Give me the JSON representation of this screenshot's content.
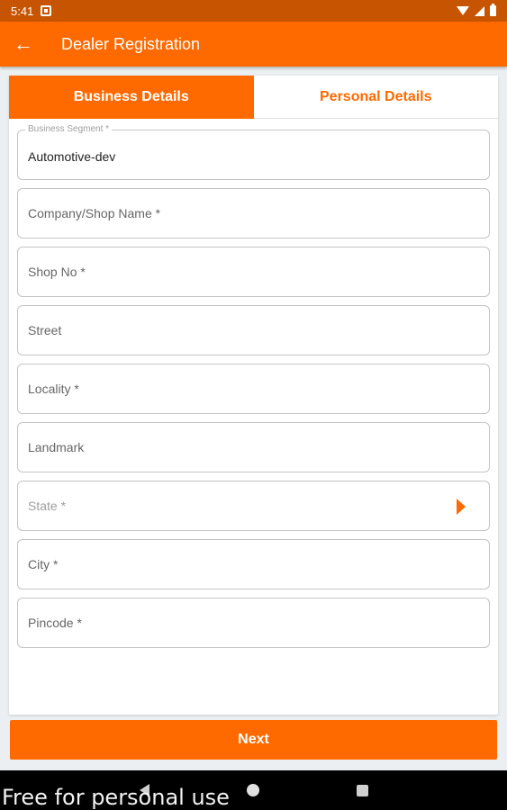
{
  "status_bar": {
    "time": "5:41"
  },
  "app_bar": {
    "title": "Dealer Registration",
    "back_icon": "arrow-left-icon"
  },
  "tabs": [
    {
      "label": "Business Details",
      "active": true
    },
    {
      "label": "Personal Details",
      "active": false
    }
  ],
  "form": {
    "business_segment": {
      "label": "Business Segment *",
      "value": "Automotive-dev"
    },
    "company_name": {
      "placeholder": "Company/Shop Name *"
    },
    "shop_no": {
      "placeholder": "Shop No *"
    },
    "street": {
      "placeholder": "Street"
    },
    "locality": {
      "placeholder": "Locality *"
    },
    "landmark": {
      "placeholder": "Landmark"
    },
    "state": {
      "placeholder": "State *"
    },
    "city": {
      "placeholder": "City *"
    },
    "pincode": {
      "placeholder": "Pincode *"
    }
  },
  "next_button": {
    "label": "Next"
  },
  "watermark": "Free for personal use",
  "colors": {
    "primary": "#ff6a00",
    "status_bar": "#c75400"
  }
}
